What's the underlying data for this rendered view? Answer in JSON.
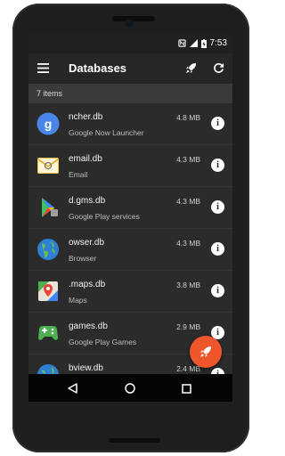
{
  "status_bar": {
    "time": "7:53",
    "icons": [
      "nfc-icon",
      "signal-icon",
      "battery-charging-icon"
    ]
  },
  "toolbar": {
    "title": "Databases",
    "menu_icon": "hamburger-menu-icon",
    "actions": [
      "rocket-icon",
      "refresh-icon"
    ]
  },
  "subheader": {
    "count_label": "7 items"
  },
  "databases": [
    {
      "name": "ncher.db",
      "app": "Google Now Launcher",
      "size": "4.8 MB",
      "icon": "google-g-icon"
    },
    {
      "name": "email.db",
      "app": "Email",
      "size": "4.3 MB",
      "icon": "email-icon"
    },
    {
      "name": "d.gms.db",
      "app": "Google Play services",
      "size": "4.3 MB",
      "icon": "play-services-icon"
    },
    {
      "name": "owser.db",
      "app": "Browser",
      "size": "4.3 MB",
      "icon": "browser-globe-icon"
    },
    {
      "name": ".maps.db",
      "app": "Maps",
      "size": "3.8 MB",
      "icon": "maps-icon"
    },
    {
      "name": "games.db",
      "app": "Google Play Games",
      "size": "2.9 MB",
      "icon": "play-games-icon"
    },
    {
      "name": "bview.db",
      "app": "",
      "size": "2.4 MB",
      "icon": "webview-globe-icon"
    }
  ],
  "info_icon_text": "i",
  "fab": {
    "icon": "rocket-icon"
  },
  "nav_bar": [
    "back-icon",
    "home-icon",
    "recents-icon"
  ],
  "colors": {
    "accent": "#f0562b",
    "background": "#2b2b2b",
    "toolbar": "#262626",
    "subheader": "#3a3a3a"
  }
}
